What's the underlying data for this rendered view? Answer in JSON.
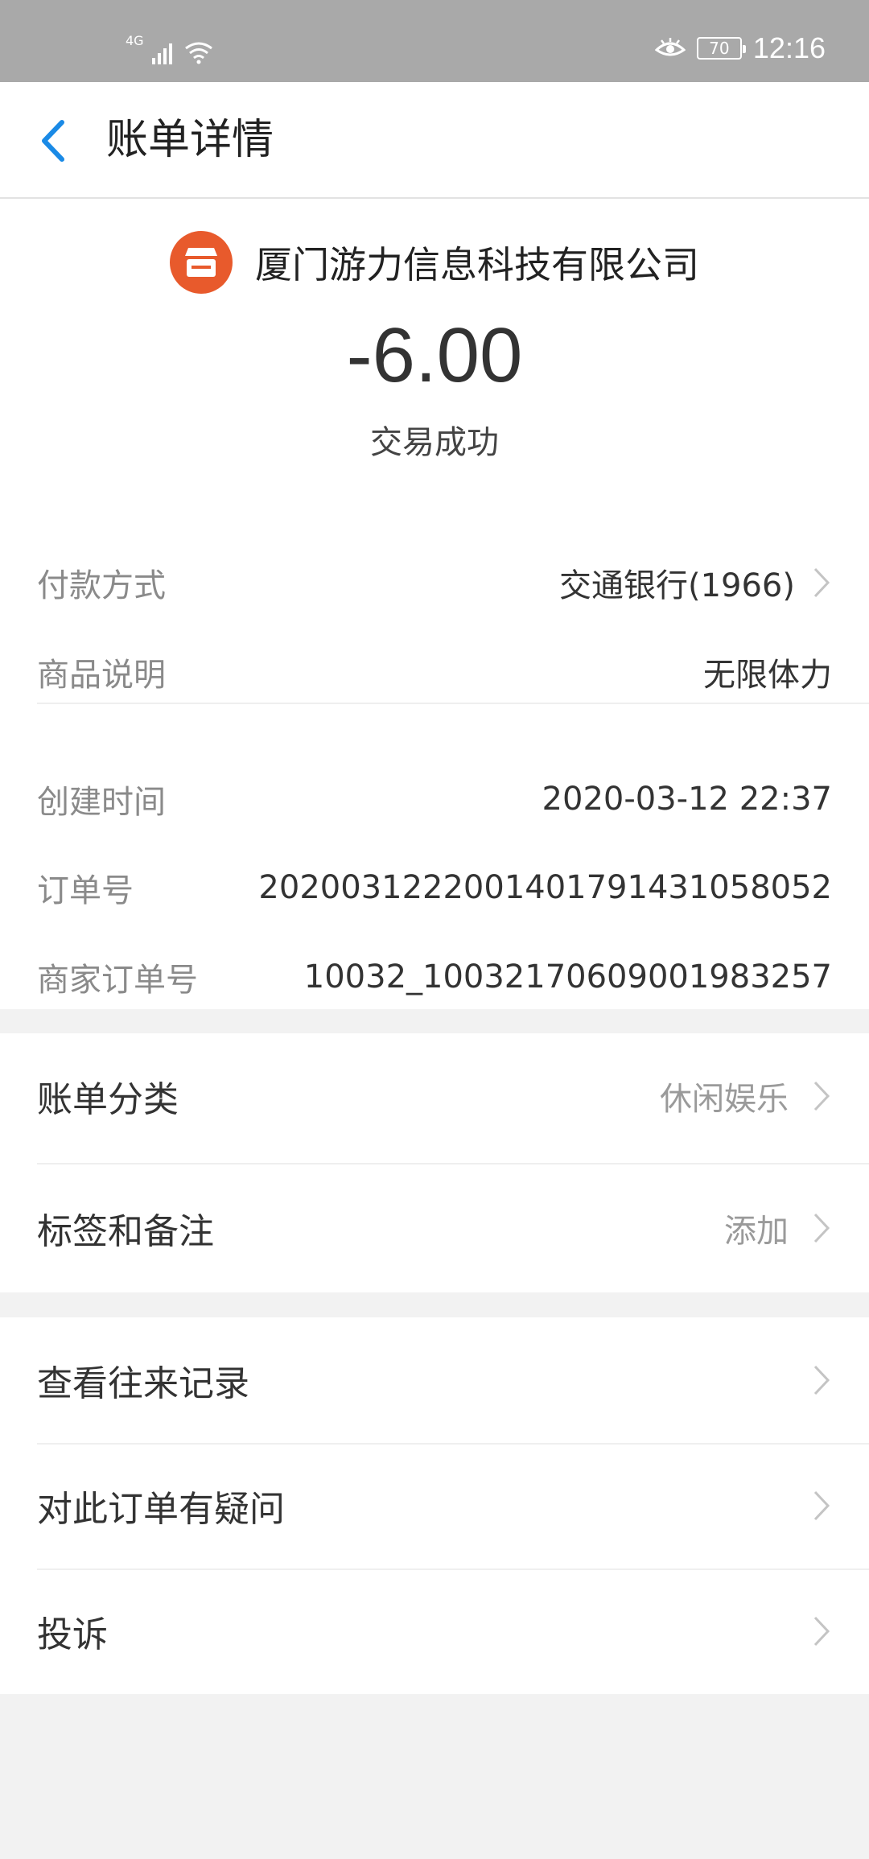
{
  "status_bar": {
    "network": "4G",
    "battery": "70",
    "time": "12:16"
  },
  "header": {
    "title": "账单详情"
  },
  "summary": {
    "merchant_name": "厦门游力信息科技有限公司",
    "amount": "-6.00",
    "status": "交易成功"
  },
  "details": {
    "payment_method_label": "付款方式",
    "payment_method_value": "交通银行(1966)",
    "product_label": "商品说明",
    "product_value": "无限体力",
    "created_label": "创建时间",
    "created_value": "2020-03-12 22:37",
    "order_no_label": "订单号",
    "order_no_value": "2020031222001401791431058052",
    "merchant_order_label": "商家订单号",
    "merchant_order_value": "10032_10032170609001983257"
  },
  "category_section": {
    "category_label": "账单分类",
    "category_value": "休闲娱乐",
    "tags_label": "标签和备注",
    "tags_value": "添加"
  },
  "actions": {
    "history": "查看往来记录",
    "question": "对此订单有疑问",
    "complaint": "投诉"
  },
  "colors": {
    "accent_blue": "#1a8ae6",
    "merchant_orange": "#e85a2c"
  }
}
